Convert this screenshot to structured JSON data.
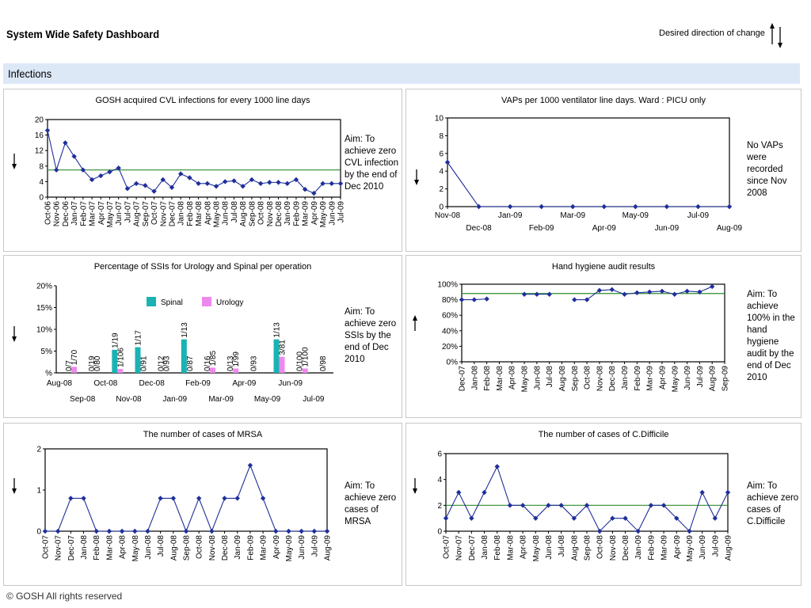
{
  "header": {
    "title": "System Wide Safety Dashboard",
    "direction_label": "Desired direction of change"
  },
  "section": {
    "label": "Infections"
  },
  "footer": {
    "text": "© GOSH All rights reserved"
  },
  "colors": {
    "line": "#1f2f9a",
    "marker": "#1f2f9a",
    "aim_line": "#2e8b2e",
    "section_bg": "#dde8f7",
    "spinal": "#1ab3b3",
    "urology": "#ee88ee"
  },
  "panels": {
    "cvl": {
      "aim": "Aim: To achieve zero CVL infection by the end of Dec 2010",
      "direction": "down",
      "chart_data": {
        "type": "line",
        "title": "GOSH acquired CVL infections for every 1000 line days",
        "categories": [
          "Oct-06",
          "Nov-06",
          "Dec-06",
          "Jan-07",
          "Feb-07",
          "Mar-07",
          "Apr-07",
          "May-07",
          "Jun-07",
          "Jul-07",
          "Aug-07",
          "Sep-07",
          "Oct-07",
          "Nov-07",
          "Dec-07",
          "Jan-08",
          "Feb-08",
          "Mar-08",
          "Apr-08",
          "May-08",
          "Jun-08",
          "Jul-08",
          "Aug-08",
          "Sep-08",
          "Oct-08",
          "Nov-08",
          "Dec-08",
          "Jan-09",
          "Feb-09",
          "Mar-09",
          "Apr-09",
          "May-09",
          "Jun-09",
          "Jul-09"
        ],
        "values": [
          17.2,
          7,
          14,
          10.5,
          7,
          4.5,
          5.5,
          6.5,
          7.5,
          2.2,
          3.5,
          3,
          1.5,
          4.5,
          2.5,
          6,
          5,
          3.5,
          3.5,
          2.8,
          4,
          4.2,
          2.8,
          4.5,
          3.5,
          3.8,
          3.8,
          3.5,
          4.5,
          2,
          1,
          3.5,
          3.5,
          3.5
        ],
        "aim_line": 7,
        "yticks": [
          "0",
          "4",
          "8",
          "12",
          "16",
          "20"
        ],
        "ylim": [
          0,
          20
        ],
        "grid": false
      }
    },
    "vap": {
      "aim": "No VAPs were recorded since Nov 2008",
      "direction": "down",
      "chart_data": {
        "type": "line",
        "title": "VAPs per 1000 ventilator line days. Ward : PICU only",
        "categories": [
          "Nov-08",
          "Dec-08",
          "Jan-09",
          "Feb-09",
          "Mar-09",
          "Apr-09",
          "May-09",
          "Jun-09",
          "Jul-09",
          "Aug-09"
        ],
        "values": [
          5,
          0,
          0,
          0,
          0,
          0,
          0,
          0,
          0,
          0
        ],
        "yticks": [
          "0",
          "2",
          "4",
          "6",
          "8",
          "10"
        ],
        "ylim": [
          0,
          10
        ],
        "grid": false
      }
    },
    "ssi": {
      "aim": "Aim: To achieve zero SSIs by the end of Dec 2010",
      "direction": "down",
      "chart_data": {
        "type": "bar",
        "title": "Percentage of SSIs for Urology and Spinal per operation",
        "categories": [
          "Aug-08",
          "Sep-08",
          "Oct-08",
          "Nov-08",
          "Dec-08",
          "Jan-09",
          "Feb-09",
          "Mar-09",
          "Apr-09",
          "May-09",
          "Jun-09",
          "Jul-09"
        ],
        "series": [
          {
            "name": "Spinal",
            "values": [
              0,
              0,
              5.3,
              5.9,
              0,
              7.7,
              0,
              0,
              0,
              7.7,
              0,
              0
            ],
            "labels": [
              "0/7",
              "0/19",
              "1/19",
              "1/17",
              "0/12",
              "1/13",
              "0/16",
              "0/13",
              "0/93",
              "1/13",
              "0/100",
              "0/98"
            ]
          },
          {
            "name": "Urology",
            "values": [
              1.4,
              0,
              0.9,
              0,
              0,
              0,
              1.2,
              1,
              0,
              3.7,
              1,
              0
            ],
            "labels": [
              "1/70",
              "0/80",
              "1/106",
              "0/91",
              "0/93",
              "0/87",
              "1/85",
              "1/99",
              "",
              "3/81",
              "1/100",
              ""
            ]
          }
        ],
        "yticks": [
          "%",
          "5%",
          "10%",
          "15%",
          "20%"
        ],
        "ylim": [
          0,
          20
        ],
        "legend_position": "top-center",
        "grid": false
      }
    },
    "hand": {
      "aim": "Aim: To achieve 100% in the hand hygiene audit by the end of Dec 2010",
      "direction": "up",
      "chart_data": {
        "type": "line",
        "title": "Hand hygiene audit results",
        "categories": [
          "Dec-07",
          "Jan-08",
          "Feb-08",
          "Mar-08",
          "Apr-08",
          "May-08",
          "Jun-08",
          "Jul-08",
          "Aug-08",
          "Sep-08",
          "Oct-08",
          "Nov-08",
          "Dec-08",
          "Jan-09",
          "Feb-09",
          "Mar-09",
          "Apr-09",
          "May-09",
          "Jun-09",
          "Jul-09",
          "Aug-09",
          "Sep-09"
        ],
        "values": [
          80,
          80,
          81,
          null,
          null,
          87,
          87,
          87,
          null,
          80,
          80,
          92,
          93,
          87,
          89,
          90,
          91,
          87,
          91,
          90,
          97,
          null
        ],
        "aim_line": 88,
        "yticks": [
          "0%",
          "20%",
          "40%",
          "60%",
          "80%",
          "100%"
        ],
        "ylim": [
          0,
          100
        ],
        "grid": false
      }
    },
    "mrsa": {
      "aim": "Aim: To achieve zero cases of MRSA",
      "direction": "down",
      "chart_data": {
        "type": "line",
        "title": "The number of cases of MRSA",
        "categories": [
          "Oct-07",
          "Nov-07",
          "Dec-07",
          "Jan-08",
          "Feb-08",
          "Mar-08",
          "Apr-08",
          "May-08",
          "Jun-08",
          "Jul-08",
          "Aug-08",
          "Sep-08",
          "Oct-08",
          "Nov-08",
          "Dec-08",
          "Jan-09",
          "Feb-09",
          "Mar-09",
          "Apr-09",
          "May-09",
          "Jun-09",
          "Jul-09",
          "Aug-09"
        ],
        "values": [
          0,
          0,
          1,
          1,
          0,
          0,
          0,
          0,
          0,
          1,
          1,
          0,
          1,
          0,
          1,
          1,
          2,
          1,
          0,
          0,
          0,
          0,
          0
        ],
        "yticks": [
          "0",
          "1",
          "2"
        ],
        "ylim": [
          0,
          2.5
        ],
        "grid": false
      }
    },
    "cdiff": {
      "aim": "Aim: To achieve zero cases of C.Difficile",
      "direction": "down",
      "chart_data": {
        "type": "line",
        "title": "The number of cases of C.Difficile",
        "categories": [
          "Oct-07",
          "Nov-07",
          "Dec-07",
          "Jan-08",
          "Feb-08",
          "Mar-08",
          "Apr-08",
          "May-08",
          "Jun-08",
          "Jul-08",
          "Aug-08",
          "Sep-08",
          "Oct-08",
          "Nov-08",
          "Dec-08",
          "Jan-09",
          "Feb-09",
          "Mar-09",
          "Apr-09",
          "May-09",
          "Jun-09",
          "Jul-09",
          "Aug-09"
        ],
        "values": [
          1,
          3,
          1,
          3,
          5,
          2,
          2,
          1,
          2,
          2,
          1,
          2,
          0,
          1,
          1,
          0,
          2,
          2,
          1,
          0,
          3,
          1,
          3
        ],
        "aim_line": 2,
        "yticks": [
          "0",
          "2",
          "4",
          "6"
        ],
        "ylim": [
          0,
          6
        ],
        "grid": false
      }
    }
  }
}
